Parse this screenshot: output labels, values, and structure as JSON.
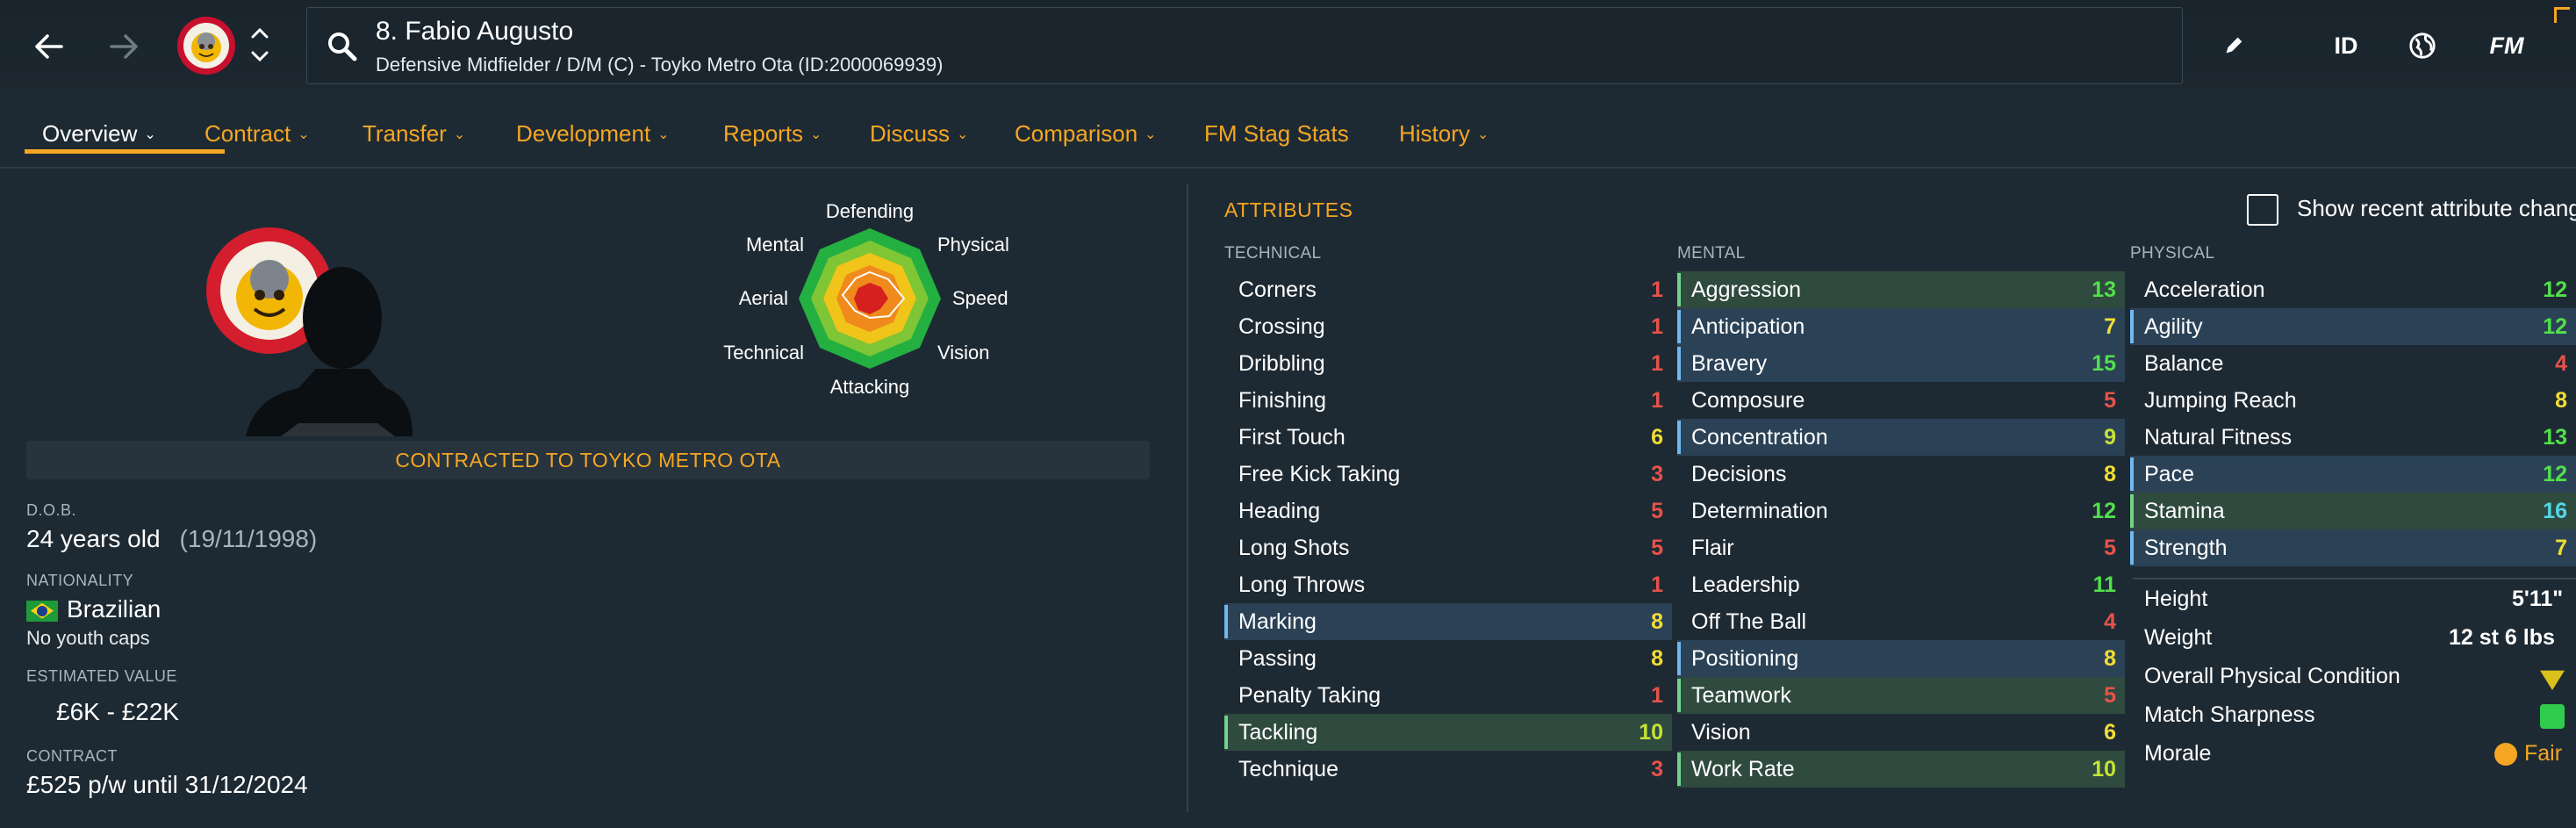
{
  "header": {
    "player_title": "8. Fabio Augusto",
    "player_subtitle": "Defensive Midfielder / D/M (C) - Toyko Metro Ota (ID:2000069939)",
    "id_button": "ID",
    "fm_button": "FM"
  },
  "tabs": [
    {
      "label": "Overview"
    },
    {
      "label": "Contract"
    },
    {
      "label": "Transfer"
    },
    {
      "label": "Development"
    },
    {
      "label": "Reports"
    },
    {
      "label": "Discuss"
    },
    {
      "label": "Comparison"
    },
    {
      "label": "FM Stag Stats"
    },
    {
      "label": "History"
    }
  ],
  "radar": {
    "labels": {
      "defending": "Defending",
      "physical": "Physical",
      "speed": "Speed",
      "vision": "Vision",
      "attacking": "Attacking",
      "technical": "Technical",
      "aerial": "Aerial",
      "mental": "Mental"
    }
  },
  "profile": {
    "contract_banner": "CONTRACTED TO TOYKO METRO OTA",
    "dob_label": "D.O.B.",
    "age": "24 years old",
    "dob": "(19/11/1998)",
    "nationality_label": "NATIONALITY",
    "nationality": "Brazilian",
    "youth_caps": "No youth caps",
    "value_label": "ESTIMATED VALUE",
    "value": "£6K - £22K",
    "contract_label": "CONTRACT",
    "contract": "£525 p/w until 31/12/2024"
  },
  "attributes": {
    "title": "ATTRIBUTES",
    "recent_changes_label": "Show recent attribute changes",
    "technical_header": "TECHNICAL",
    "mental_header": "MENTAL",
    "physical_header": "PHYSICAL",
    "technical": [
      {
        "name": "Corners",
        "value": "1"
      },
      {
        "name": "Crossing",
        "value": "1"
      },
      {
        "name": "Dribbling",
        "value": "1"
      },
      {
        "name": "Finishing",
        "value": "1"
      },
      {
        "name": "First Touch",
        "value": "6"
      },
      {
        "name": "Free Kick Taking",
        "value": "3"
      },
      {
        "name": "Heading",
        "value": "5"
      },
      {
        "name": "Long Shots",
        "value": "5"
      },
      {
        "name": "Long Throws",
        "value": "1"
      },
      {
        "name": "Marking",
        "value": "8"
      },
      {
        "name": "Passing",
        "value": "8"
      },
      {
        "name": "Penalty Taking",
        "value": "1"
      },
      {
        "name": "Tackling",
        "value": "10"
      },
      {
        "name": "Technique",
        "value": "3"
      }
    ],
    "mental": [
      {
        "name": "Aggression",
        "value": "13"
      },
      {
        "name": "Anticipation",
        "value": "7"
      },
      {
        "name": "Bravery",
        "value": "15"
      },
      {
        "name": "Composure",
        "value": "5"
      },
      {
        "name": "Concentration",
        "value": "9"
      },
      {
        "name": "Decisions",
        "value": "8"
      },
      {
        "name": "Determination",
        "value": "12"
      },
      {
        "name": "Flair",
        "value": "5"
      },
      {
        "name": "Leadership",
        "value": "11"
      },
      {
        "name": "Off The Ball",
        "value": "4"
      },
      {
        "name": "Positioning",
        "value": "8"
      },
      {
        "name": "Teamwork",
        "value": "5"
      },
      {
        "name": "Vision",
        "value": "6"
      },
      {
        "name": "Work Rate",
        "value": "10"
      }
    ],
    "physical": [
      {
        "name": "Acceleration",
        "value": "12"
      },
      {
        "name": "Agility",
        "value": "12"
      },
      {
        "name": "Balance",
        "value": "4"
      },
      {
        "name": "Jumping Reach",
        "value": "8"
      },
      {
        "name": "Natural Fitness",
        "value": "13"
      },
      {
        "name": "Pace",
        "value": "12"
      },
      {
        "name": "Stamina",
        "value": "16"
      },
      {
        "name": "Strength",
        "value": "7"
      }
    ],
    "details": {
      "height_label": "Height",
      "height": "5'11\"",
      "weight_label": "Weight",
      "weight": "12 st 6 lbs",
      "condition_label": "Overall Physical Condition",
      "sharpness_label": "Match Sharpness",
      "morale_label": "Morale",
      "morale": "Fair"
    }
  },
  "colors": {
    "accent": "#f5a623",
    "value_low": "#e8524a",
    "value_mid": "#f2dd34",
    "value_good": "#c6e235",
    "value_high": "#52e04c",
    "value_top": "#52d7e8"
  }
}
